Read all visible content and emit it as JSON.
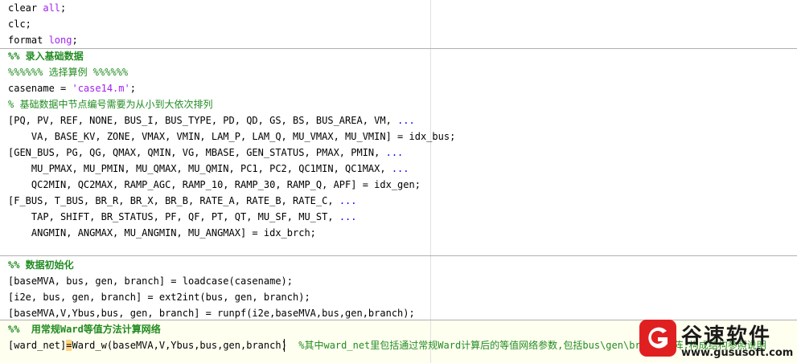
{
  "editor": {
    "lines": [
      {
        "parts": [
          {
            "t": "clear ",
            "c": ""
          },
          {
            "t": "all",
            "c": "str"
          },
          {
            "t": ";",
            "c": ""
          }
        ]
      },
      {
        "parts": [
          {
            "t": "clc;",
            "c": ""
          }
        ]
      },
      {
        "parts": [
          {
            "t": "format ",
            "c": ""
          },
          {
            "t": "long",
            "c": "str"
          },
          {
            "t": ";",
            "c": ""
          }
        ]
      },
      {
        "parts": [
          {
            "t": "%% 录入基础数据",
            "c": "cell"
          }
        ]
      },
      {
        "parts": [
          {
            "t": "%%%%%% 选择算例 %%%%%%",
            "c": "cmt"
          }
        ]
      },
      {
        "parts": [
          {
            "t": "casename = ",
            "c": ""
          },
          {
            "t": "'case14.m'",
            "c": "str"
          },
          {
            "t": ";",
            "c": ""
          }
        ]
      },
      {
        "parts": [
          {
            "t": "% 基础数据中节点编号需要为从小到大依次排列",
            "c": "cmt"
          }
        ]
      },
      {
        "parts": [
          {
            "t": "[PQ, PV, REF, NONE, BUS_I, BUS_TYPE, PD, QD, GS, BS, BUS_AREA, VM, ",
            "c": ""
          },
          {
            "t": "...",
            "c": "kw"
          }
        ]
      },
      {
        "parts": [
          {
            "t": "    VA, BASE_KV, ZONE, VMAX, VMIN, LAM_P, LAM_Q, MU_VMAX, MU_VMIN] = idx_bus;",
            "c": ""
          }
        ]
      },
      {
        "parts": [
          {
            "t": "[GEN_BUS, PG, QG, QMAX, QMIN, VG, MBASE, GEN_STATUS, PMAX, PMIN, ",
            "c": ""
          },
          {
            "t": "...",
            "c": "kw"
          }
        ]
      },
      {
        "parts": [
          {
            "t": "    MU_PMAX, MU_PMIN, MU_QMAX, MU_QMIN, PC1, PC2, QC1MIN, QC1MAX, ",
            "c": ""
          },
          {
            "t": "...",
            "c": "kw"
          }
        ]
      },
      {
        "parts": [
          {
            "t": "    QC2MIN, QC2MAX, RAMP_AGC, RAMP_10, RAMP_30, RAMP_Q, APF] = idx_gen;",
            "c": ""
          }
        ]
      },
      {
        "parts": [
          {
            "t": "[F_BUS, T_BUS, BR_R, BR_X, BR_B, RATE_A, RATE_B, RATE_C, ",
            "c": ""
          },
          {
            "t": "...",
            "c": "kw"
          }
        ]
      },
      {
        "parts": [
          {
            "t": "    TAP, SHIFT, BR_STATUS, PF, QF, PT, QT, MU_SF, MU_ST, ",
            "c": ""
          },
          {
            "t": "...",
            "c": "kw"
          }
        ]
      },
      {
        "parts": [
          {
            "t": "    ANGMIN, ANGMAX, MU_ANGMIN, MU_ANGMAX] = idx_brch;",
            "c": ""
          }
        ]
      },
      {
        "parts": []
      },
      {
        "parts": [
          {
            "t": "%% 数据初始化",
            "c": "cell"
          }
        ]
      },
      {
        "parts": [
          {
            "t": "[baseMVA, bus, gen, branch] = loadcase(casename);",
            "c": ""
          }
        ]
      },
      {
        "parts": [
          {
            "t": "[i2e, bus, gen, branch] = ext2int(bus, gen, branch);",
            "c": ""
          }
        ]
      },
      {
        "parts": [
          {
            "t": "[baseMVA,V,Ybus,bus, gen, branch] = runpf(i2e,baseMVA,bus,gen,branch);",
            "c": ""
          }
        ]
      },
      {
        "parts": [
          {
            "t": "%%  用常规Ward等值方法计算网络",
            "c": "cell"
          }
        ]
      },
      {
        "parts": [
          {
            "t": "[ward_net]",
            "c": ""
          },
          {
            "t": "=",
            "c": "hl"
          },
          {
            "t": "Ward_w(baseMVA,V,Ybus,bus,gen,branch)  ",
            "c": ""
          },
          {
            "t": "%其中ward_net里包括通过常规Ward计算后的等值网络参数,包括bus\\gen\\branch矩阵,构成结构参照说明",
            "c": "cmt"
          }
        ]
      }
    ]
  },
  "watermark": {
    "title": "谷速软件",
    "url": "www.gususoft.com",
    "accent": "#e02020"
  }
}
